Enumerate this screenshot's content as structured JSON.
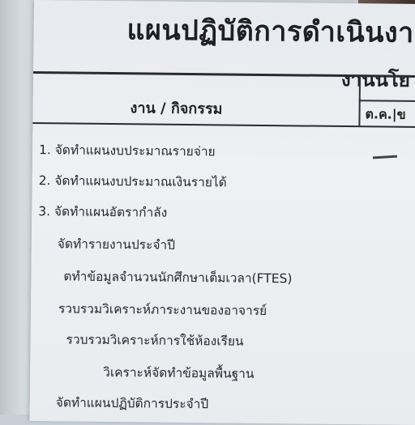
{
  "document": {
    "title": "แผนปฏิบัติการดำเนินงา",
    "subtitle": "งานนโย",
    "table": {
      "column_header": "งาน / กิจกรรม",
      "month_cell": "ต.ค.|ข"
    },
    "items": [
      "1. จัดทำแผนงบประมาณรายจ่าย",
      "2. จัดทำแผนงบประมาณเงินรายได้",
      "3. จัดทำแผนอัตรากำลัง",
      "จัดทำรายงานประจำปี",
      "ตทำข้อมูลจำนวนนักศึกษาเต็มเวลา(FTES)",
      "รวบรวมวิเคราะห์ภาระงานของอาจารย์",
      "รวบรวมวิเคราะห์การใช้ห้องเรียน",
      "วิเคราะห์จัดทำข้อมูลพื้นฐาน",
      "จัดทำแผนปฏิบัติการประจำปี"
    ]
  }
}
